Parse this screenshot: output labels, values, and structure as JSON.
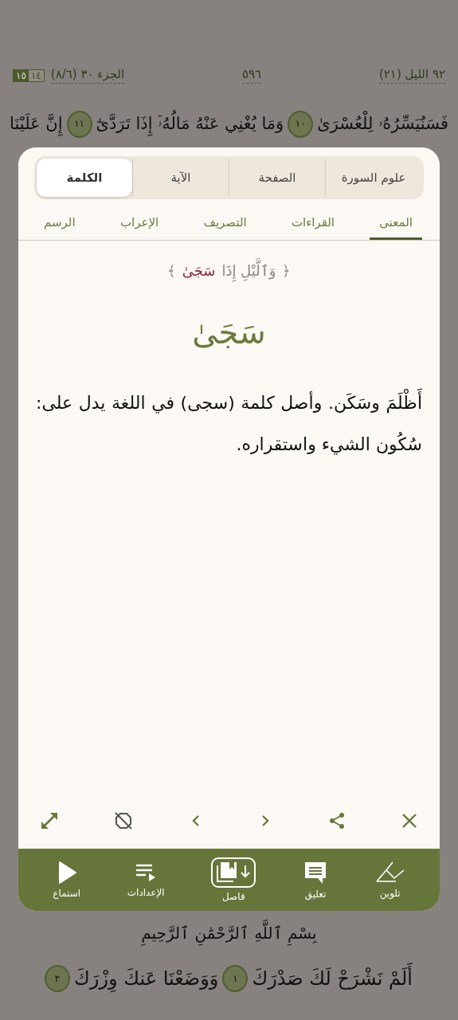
{
  "header": {
    "surah": "٩٢ الليل (٢١)",
    "page": "٥٩٦",
    "juz": "الجزء ٣٠ (٨/٦)",
    "hizb": [
      {
        "text": "١٤",
        "selected": false
      },
      {
        "text": "١٥",
        "selected": true
      }
    ]
  },
  "top_verse": [
    {
      "kind": "text",
      "text": "فَسَنُيَسِّرُهُۥ لِلْعُسْرَىٰ"
    },
    {
      "kind": "marker",
      "text": "١٠"
    },
    {
      "kind": "text",
      "text": "وَمَا يُغْنِي عَنْهُ مَالُهُۥٓ إِذَا تَرَدَّىٰٓ"
    },
    {
      "kind": "marker",
      "text": "١١"
    },
    {
      "kind": "text",
      "text": "إِنَّ عَلَيْنَا"
    }
  ],
  "popup": {
    "tabs": [
      {
        "label": "علوم السورة",
        "selected": false
      },
      {
        "label": "الصفحة",
        "selected": false
      },
      {
        "label": "الآية",
        "selected": false
      },
      {
        "label": "الكلمة",
        "selected": true
      }
    ],
    "subtabs": [
      {
        "label": "المعنى",
        "selected": true
      },
      {
        "label": "القراءات",
        "selected": false
      },
      {
        "label": "التصريف",
        "selected": false
      },
      {
        "label": "الإعراب",
        "selected": false
      },
      {
        "label": "الرسم",
        "selected": false
      }
    ],
    "quote": {
      "open": "﴿",
      "before": "وَٱلَّيْلِ إِذَا",
      "highlight": "سَجَىٰ",
      "close": "﴾"
    },
    "word": "سَجَىٰ",
    "meaning": "أَظْلَمَ وسَكَن. وأصل كلمة (سجى) في اللغة يدل على: سُكُون الشيء واستقراره.",
    "tools": [
      {
        "kind": "close"
      },
      {
        "kind": "share"
      },
      {
        "kind": "next"
      },
      {
        "kind": "prev"
      },
      {
        "kind": "hide"
      },
      {
        "kind": "expand"
      }
    ],
    "actions": [
      {
        "kind": "color",
        "label": "تلوين"
      },
      {
        "kind": "comment",
        "label": "تعليق"
      },
      {
        "kind": "bookmark",
        "label": "فاصل"
      },
      {
        "kind": "settings",
        "label": "الإعدادات"
      },
      {
        "kind": "play",
        "label": "استماع"
      }
    ]
  },
  "basmala": "بِسْمِ ٱللَّهِ ٱلرَّحْمَٰنِ ٱلرَّحِيمِ",
  "bottom_verse": [
    {
      "kind": "text",
      "text": "أَلَمْ نَشْرَحْ لَكَ صَدْرَكَ"
    },
    {
      "kind": "marker",
      "text": "١"
    },
    {
      "kind": "text",
      "text": "وَوَضَعْنَا عَنكَ وِزْرَكَ"
    },
    {
      "kind": "marker",
      "text": "٢"
    }
  ]
}
